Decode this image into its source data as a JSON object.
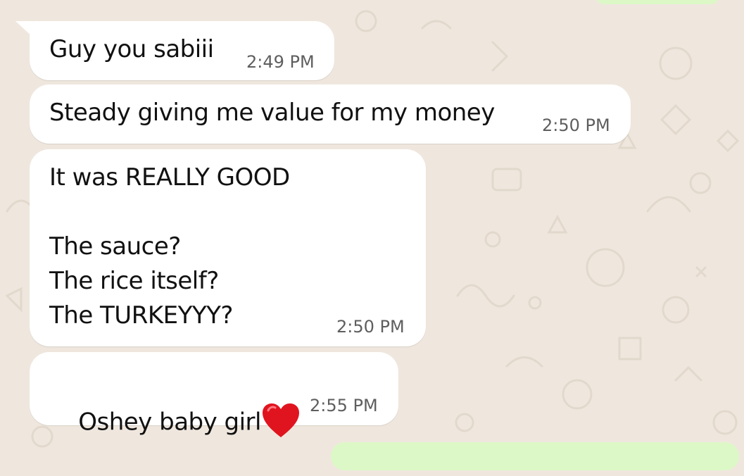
{
  "chat": {
    "messages": [
      {
        "text": "Guy you sabiii",
        "time": "2:49 PM"
      },
      {
        "text": "Steady giving me value for my money",
        "time": "2:50 PM"
      },
      {
        "text": "It was REALLY GOOD\n\nThe sauce?\nThe rice itself?\nThe TURKEYYY?",
        "time": "2:50 PM"
      },
      {
        "text": "Oshey baby girl",
        "time": "2:55 PM",
        "emoji": "red-heart"
      }
    ]
  },
  "colors": {
    "wallpaper": "#efe7de",
    "incoming_bubble": "#ffffff",
    "outgoing_bubble": "#dcf8c6",
    "text": "#111111",
    "timestamp": "#5e5e5e",
    "heart": "#e0141f"
  }
}
